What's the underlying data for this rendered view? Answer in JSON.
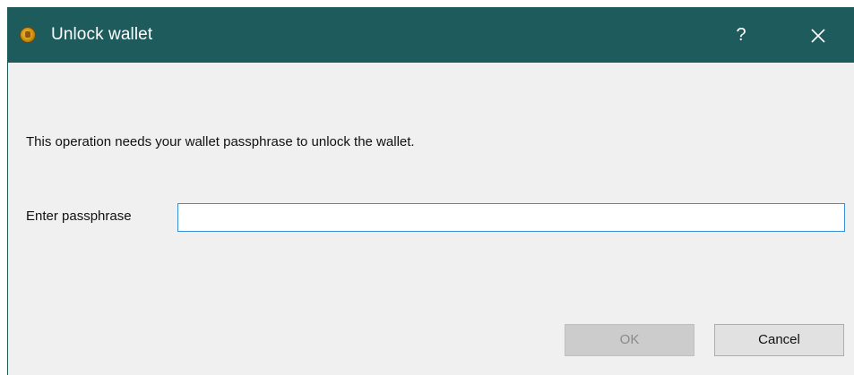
{
  "window": {
    "title": "Unlock wallet",
    "help_label": "?",
    "app_icon": "coin-logo-icon",
    "close_icon": "close-icon",
    "titlebar_color": "#1e5b5d",
    "background_color": "#f0f0f0"
  },
  "dialog": {
    "message": "This operation needs your wallet passphrase to unlock the wallet.",
    "passphrase_label": "Enter passphrase",
    "passphrase_value": ""
  },
  "buttons": {
    "ok_label": "OK",
    "ok_enabled": false,
    "cancel_label": "Cancel"
  }
}
